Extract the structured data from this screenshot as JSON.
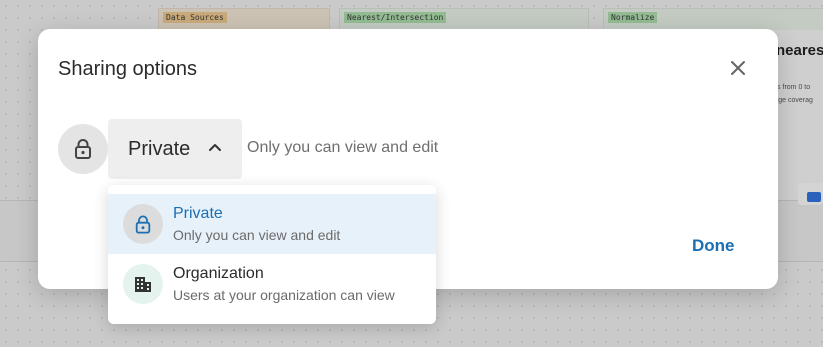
{
  "background": {
    "node_tags": [
      "Data Sources",
      "Nearest/Intersection",
      "Normalize"
    ],
    "panel_title": "neares",
    "panel_line1": "ics from 0 to",
    "panel_line2": "rage coverag"
  },
  "modal": {
    "title": "Sharing options",
    "close_icon": "close-icon",
    "current_visibility": "Private",
    "current_description": "Only you can view and edit",
    "done_label": "Done"
  },
  "dropdown": {
    "options": [
      {
        "label": "Private",
        "description": "Only you can view and edit",
        "icon": "lock-icon",
        "selected": true
      },
      {
        "label": "Organization",
        "description": "Users at your organization can view",
        "icon": "building-icon",
        "selected": false
      }
    ]
  },
  "colors": {
    "accent": "#1a6fb5",
    "selected_bg": "#e7f1fa",
    "org_icon_bg": "#e4f3ee"
  }
}
